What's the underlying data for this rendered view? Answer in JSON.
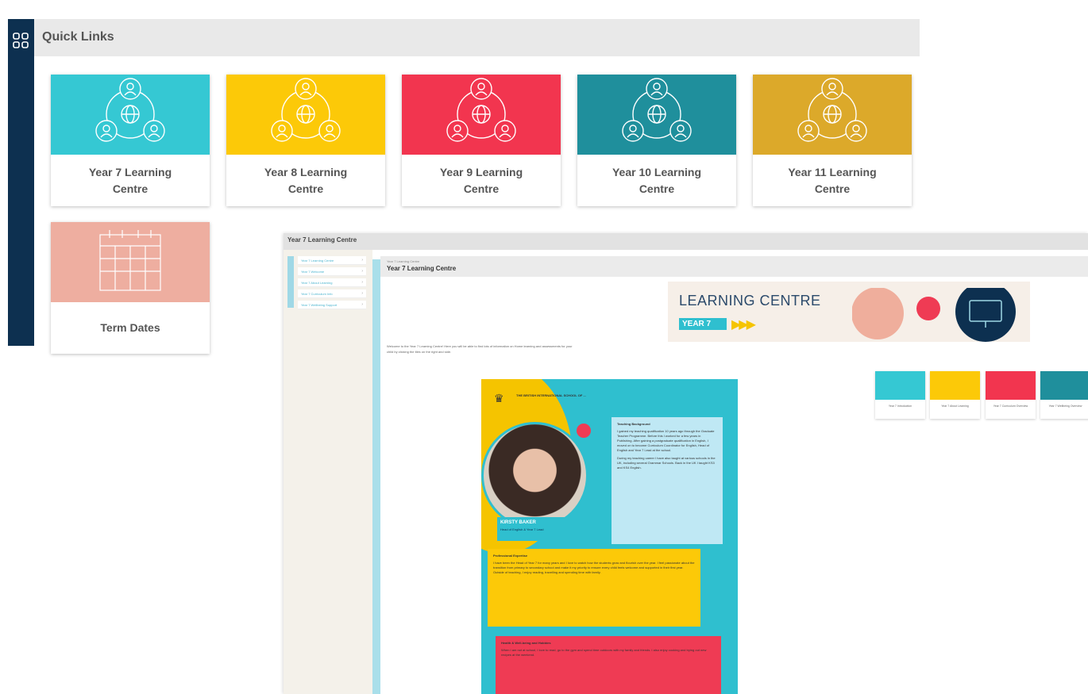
{
  "quick_links": {
    "title": "Quick Links",
    "menu_icon": "grid-icon",
    "cards": [
      {
        "label": "Year 7 Learning Centre",
        "color": "#35c8d3",
        "icon": "people-network-icon"
      },
      {
        "label": "Year 8 Learning Centre",
        "color": "#fcc908",
        "icon": "people-network-icon"
      },
      {
        "label": "Year 9 Learning Centre",
        "color": "#f2354f",
        "icon": "people-network-icon"
      },
      {
        "label": "Year 10 Learning Centre",
        "color": "#1f8f9c",
        "icon": "people-network-icon"
      },
      {
        "label": "Year 11 Learning Centre",
        "color": "#dca92a",
        "icon": "people-network-icon"
      },
      {
        "label": "Term Dates",
        "color": "#eeaea0",
        "icon": "calendar-icon"
      }
    ]
  },
  "learning_centre": {
    "window_title": "Year 7 Learning Centre",
    "breadcrumb": "Year 7 Learning Centre",
    "page_title": "Year 7 Learning Centre",
    "nav_items": [
      {
        "label": "Year 7 Learning Centre"
      },
      {
        "label": "Year 7 Welcome"
      },
      {
        "label": "Year 7 About Learning"
      },
      {
        "label": "Year 7 Curriculum Info"
      },
      {
        "label": "Year 7 Wellbeing Support"
      }
    ],
    "intro": "Welcome to the Year 7 Learning Centre! Here you will be able to find lots of information on Home learning and assessments for your child by clicking the tiles on the right and side.",
    "banner": {
      "title": "LEARNING CENTRE",
      "year": "YEAR 7",
      "arrows": "▶▶▶"
    },
    "mini_tiles": [
      {
        "label": "Year 7 Introduction",
        "color": "#35c8d3"
      },
      {
        "label": "Year 7 About Learning",
        "color": "#fcc908"
      },
      {
        "label": "Year 7 Curriculum Overview",
        "color": "#f2354f"
      },
      {
        "label": "Year 7 Wellbeing Overview",
        "color": "#1f8f9c"
      }
    ],
    "poster": {
      "school": "THE BRITISH INTERNATIONAL SCHOOL OF ...",
      "name": "KIRSTY BAKER",
      "role": "Head of English & Year 7 Lead",
      "teaching_heading": "Teaching Background",
      "teaching_text_1": "I gained my teaching qualification 10 years ago through the Graduate Teacher Programme. Before this I worked for a few years in Publishing. After gaining a postgraduate qualification in English, I moved on to become Curriculum Coordinator for English, Head of English and Year 7 Lead at the school.",
      "teaching_text_2": "During my teaching career I have also taught at various schools in the UK, including several Grammar Schools. Back in the UK I taught KS3 and KS4 English.",
      "expertise_heading": "Professional Expertise",
      "expertise_text": "I have been the Head of Year 7 for many years and I love to watch how the students grow and flourish over the year. I feel passionate about the transition from primary to secondary school and make it my priority to ensure every child feels welcome and supported in their first year. Outside of teaching, I enjoy reading, travelling and spending time with family.",
      "hobbies_heading": "Health & Well-being and Hobbies",
      "hobbies_text": "When I am not at school, I love to read, go to the gym and spend time outdoors with my family and friends. I also enjoy cooking and trying out new recipes at the weekend."
    }
  }
}
